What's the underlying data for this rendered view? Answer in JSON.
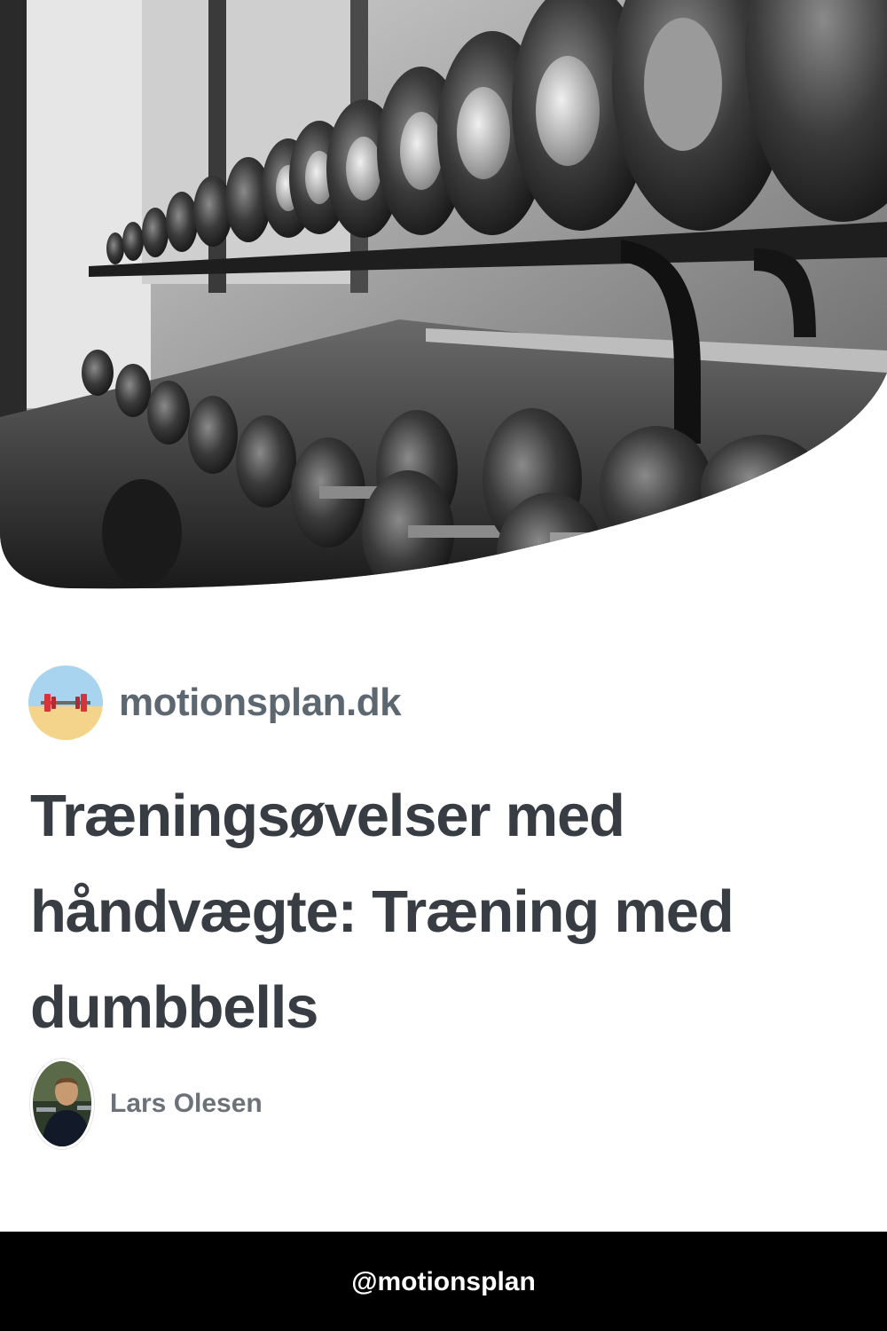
{
  "site": {
    "name": "motionsplan.dk"
  },
  "article": {
    "title": "Træningsøvelser med håndvægte: Træning med dumbbells"
  },
  "author": {
    "name": "Lars Olesen"
  },
  "footer": {
    "handle": "@motionsplan"
  },
  "colors": {
    "title": "#373d43",
    "site_name": "#5d6770",
    "author_name": "#6b7279",
    "footer_bg": "#000000",
    "footer_text": "#ffffff"
  },
  "icons": {
    "site_logo": "barbell-logo-icon",
    "author_avatar": "author-photo"
  }
}
